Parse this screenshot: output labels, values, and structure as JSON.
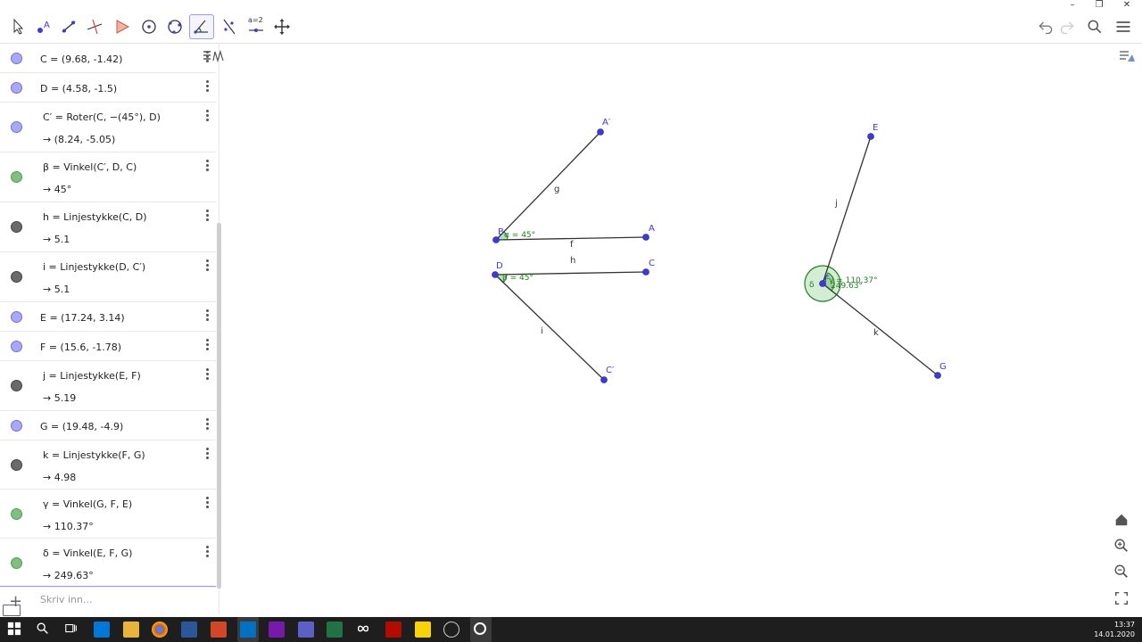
{
  "colors": {
    "accent": "#6f6fd8",
    "point": "#3a3ae0",
    "angle": "#1f7f1f",
    "segment": "#333333"
  },
  "toolbar": {
    "tools": [
      "move-tool",
      "point-tool",
      "line-tool",
      "perpendicular-tool",
      "polygon-tool",
      "circle-tool",
      "circle-3pt-tool",
      "angle-tool",
      "reflect-tool",
      "slider-tool",
      "move-graphics-tool"
    ],
    "active_tool": "angle-tool",
    "slider_label": "a=2"
  },
  "algebra": {
    "rows": [
      {
        "color": "blue",
        "def": "C = (9.68, -1.42)",
        "val": ""
      },
      {
        "color": "blue",
        "def": "D = (4.58, -1.5)",
        "val": ""
      },
      {
        "color": "blue",
        "def": "C′ = Roter(C, −(45°), D)",
        "val": "→  (8.24, -5.05)"
      },
      {
        "color": "green",
        "def": "β = Vinkel(C′, D, C)",
        "val": "→  45°"
      },
      {
        "color": "gray",
        "def": "h = Linjestykke(C, D)",
        "val": "→  5.1"
      },
      {
        "color": "gray",
        "def": "i = Linjestykke(D, C′)",
        "val": "→  5.1"
      },
      {
        "color": "blue",
        "def": "E = (17.24, 3.14)",
        "val": ""
      },
      {
        "color": "blue",
        "def": "F = (15.6, -1.78)",
        "val": ""
      },
      {
        "color": "gray",
        "def": "j = Linjestykke(E, F)",
        "val": "→  5.19"
      },
      {
        "color": "blue",
        "def": "G = (19.48, -4.9)",
        "val": ""
      },
      {
        "color": "gray",
        "def": "k = Linjestykke(F, G)",
        "val": "→  4.98"
      },
      {
        "color": "green",
        "def": "γ = Vinkel(G, F, E)",
        "val": "→  110.37°"
      },
      {
        "color": "green",
        "def": "δ = Vinkel(E, F, G)",
        "val": "→  249.63°"
      }
    ],
    "input_placeholder": "Skriv inn..."
  },
  "graphics": {
    "labels": {
      "A_prime": "A′",
      "A": "A",
      "B": "B",
      "g": "g",
      "f": "f",
      "alpha": "α = 45°",
      "D": "D",
      "C": "C",
      "h": "h",
      "beta": "β = 45°",
      "i": "i",
      "C_prime": "C′",
      "E": "E",
      "j": "j",
      "F": "F",
      "gamma": "γ = 110.37°",
      "delta": "δ",
      "delta_val": "249.63°",
      "k": "k",
      "G": "G"
    }
  },
  "taskbar": {
    "time": "13:37",
    "date": "14.01.2020"
  }
}
